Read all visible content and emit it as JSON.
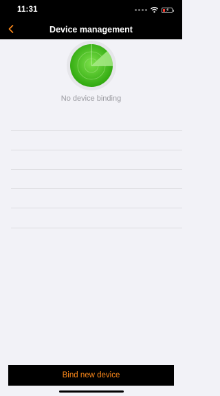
{
  "status_bar": {
    "time": "11:31",
    "icons": [
      "signal-dots-icon",
      "wifi-icon",
      "battery-charging-icon"
    ]
  },
  "nav": {
    "back_icon": "chevron-left-icon",
    "title": "Device management"
  },
  "empty_state": {
    "icon": "radar-icon",
    "message": "No device binding"
  },
  "footer": {
    "bind_label": "Bind new device"
  },
  "colors": {
    "accent": "#ff8a1a",
    "header_bg": "#000000",
    "page_bg": "#f2f2f7",
    "radar_green": "#44c81f"
  }
}
